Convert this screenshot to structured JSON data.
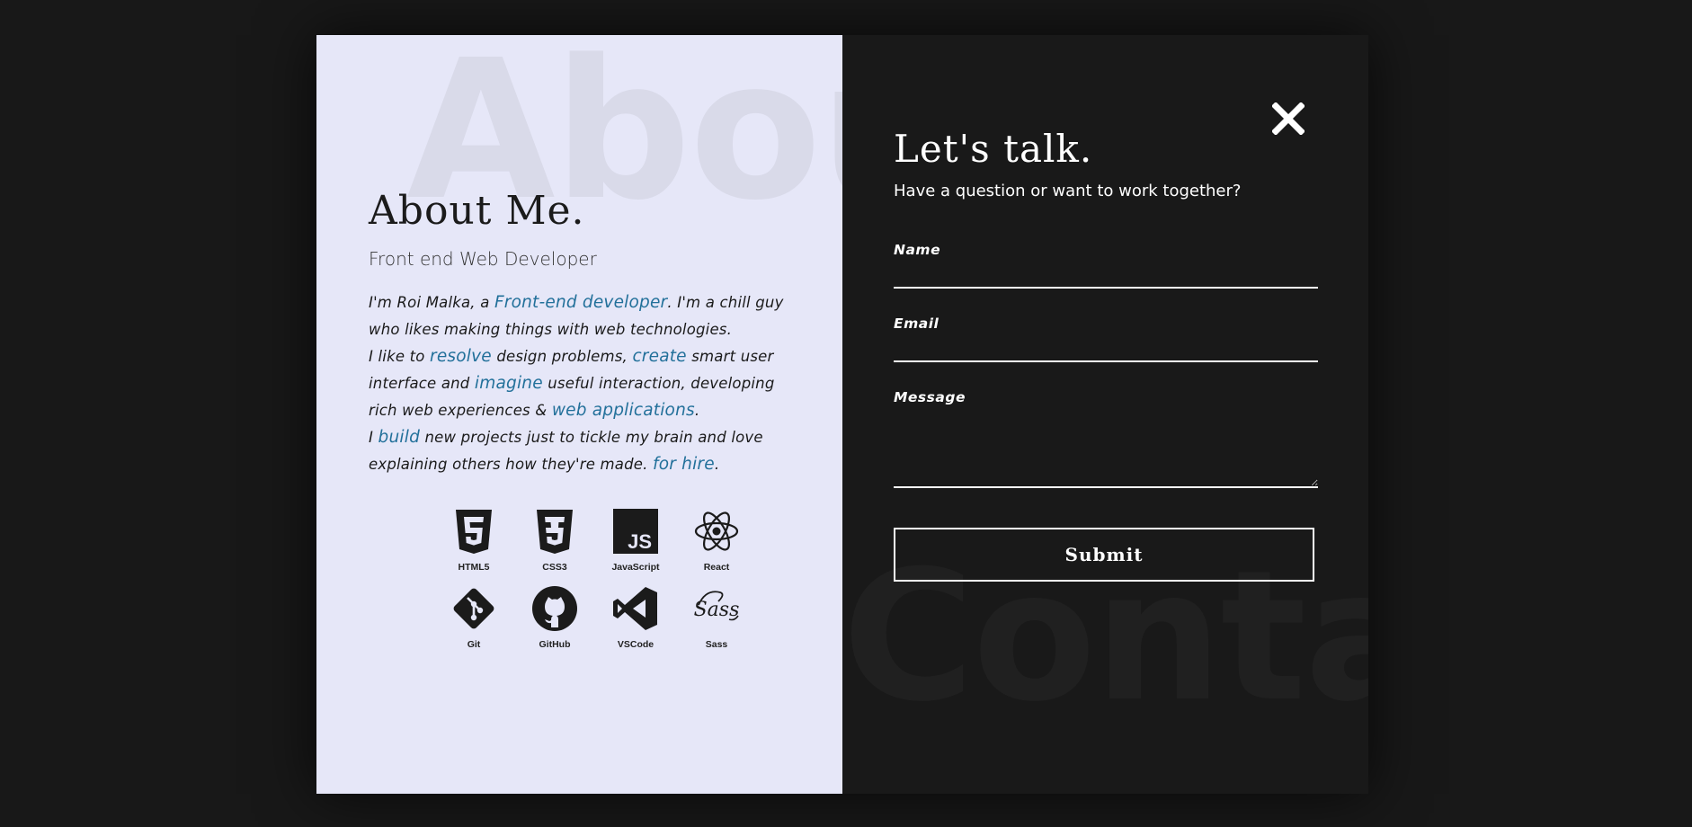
{
  "about": {
    "bg_word": "About",
    "title": "About Me.",
    "role": "Front end Web Developer",
    "bio": {
      "p1": "I'm Roi Malka, a ",
      "h1": "Front-end developer",
      "p2": ". I'm a chill guy who likes making things with web technologies.",
      "p3": "I like to ",
      "h2": "resolve",
      "p4": " design problems, ",
      "h3": "create",
      "p5": " smart user interface and ",
      "h4": "imagine",
      "p6": " useful interaction, developing rich web experiences & ",
      "h5": "web applications",
      "p7": ".",
      "p8": "I ",
      "h6": "build",
      "p9": " new projects just to tickle my brain and love explaining others how they're made. ",
      "h7": "for hire",
      "p10": "."
    },
    "skills": [
      {
        "label": "HTML5",
        "icon": "html5-icon"
      },
      {
        "label": "CSS3",
        "icon": "css3-icon"
      },
      {
        "label": "JavaScript",
        "icon": "javascript-icon"
      },
      {
        "label": "React",
        "icon": "react-icon"
      },
      {
        "label": "Git",
        "icon": "git-icon"
      },
      {
        "label": "GitHub",
        "icon": "github-icon"
      },
      {
        "label": "VSCode",
        "icon": "vscode-icon"
      },
      {
        "label": "Sass",
        "icon": "sass-icon"
      }
    ],
    "accent_color": "#22709a",
    "background_color": "#e6e7f8"
  },
  "contact": {
    "bg_word": "Conta",
    "title": "Let's talk.",
    "subtitle": "Have a question or want to work together?",
    "name_label": "Name",
    "email_label": "Email",
    "message_label": "Message",
    "submit_label": "Submit",
    "close_icon": "close-icon",
    "background_color": "#191919"
  }
}
